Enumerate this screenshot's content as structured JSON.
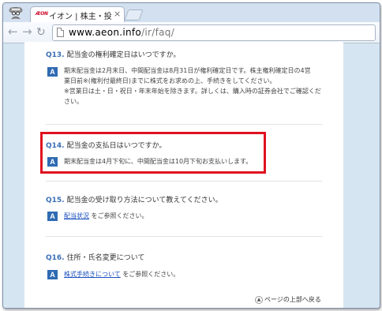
{
  "browser": {
    "tab_title": "イオン | 株主・投資家の",
    "tab_favicon_text": "ÆON",
    "url_host": "www.aeon.info",
    "url_path": "/ir/faq/"
  },
  "faq": [
    {
      "number": "Q13.",
      "question": "配当金の権利確定日はいつですか。",
      "answer_lines": [
        "期末配当金は2月末日、中間配当金は8月31日が権利確定日です。株主権利確定日の4営",
        "業日前※(権利付最終日)までに株式をお求めの上、手続きをしてください。",
        "※営業日は土・日・祝日・年末年始を除きます。詳しくは、購入時の証券会社でご確認くだ",
        "さい。"
      ]
    },
    {
      "number": "Q14.",
      "question": "配当金の支払日はいつですか。",
      "answer_lines": [
        "期末配当金は4月下旬に、中間配当金は10月下旬お支払いします。"
      ]
    },
    {
      "number": "Q15.",
      "question": "配当金の受け取り方法について教えてください。",
      "link": "配当状況",
      "answer_suffix": "をご参照ください。"
    },
    {
      "number": "Q16.",
      "question": "住所・氏名変更について",
      "link": "株式手続きについて",
      "answer_suffix": "をご参照ください。"
    }
  ],
  "answer_badge": "A",
  "back_to_top": "ページの上部へ戻る",
  "colors": {
    "highlight_border": "#e0121f",
    "badge": "#2f6bb3",
    "question_number": "#3b6fb6",
    "link": "#1a4fc0",
    "page_background": "#d5e6f2"
  },
  "icons": [
    "user-avatar-icon",
    "close-icon",
    "new-tab-icon",
    "back-arrow-icon",
    "forward-arrow-icon",
    "reload-icon",
    "page-icon",
    "arrow-up-circle-icon"
  ]
}
